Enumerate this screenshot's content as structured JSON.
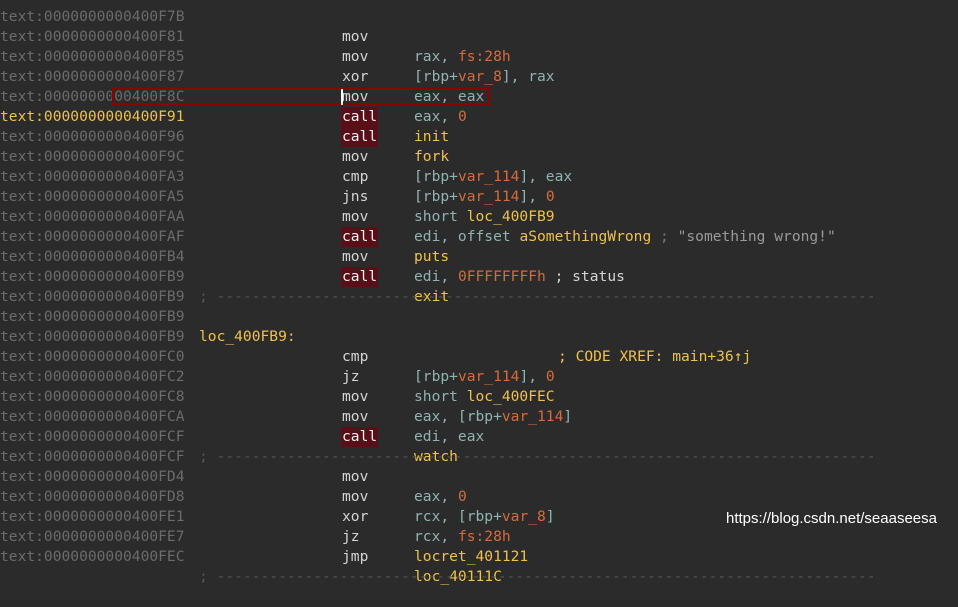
{
  "listing": {
    "top_partial": {
      "addr": "text:0000000000400F7B",
      "mn": "mov",
      "op1": "rax",
      "op2": "fs:28h"
    },
    "l1": {
      "addr": "text:0000000000400F81",
      "mn": "mov",
      "a": "[rbp+",
      "b": "var_8",
      "c": "], ",
      "d": "rax"
    },
    "l2": {
      "addr": "text:0000000000400F85",
      "mn": "xor",
      "a": "eax, eax"
    },
    "l3": {
      "addr": "text:0000000000400F87",
      "mn": "mov",
      "a": "eax, ",
      "b": "0"
    },
    "l4": {
      "addr": "text:0000000000400F8C",
      "mn": "call",
      "a": "init"
    },
    "l5": {
      "addr": "text:0000000000400F91",
      "mn": "call",
      "a": "fork"
    },
    "l6": {
      "addr": "text:0000000000400F96",
      "mn": "mov",
      "a": "[rbp+",
      "b": "var_114",
      "c": "], eax"
    },
    "l7": {
      "addr": "text:0000000000400F9C",
      "mn": "cmp",
      "a": "[rbp+",
      "b": "var_114",
      "c": "], ",
      "d": "0"
    },
    "l8": {
      "addr": "text:0000000000400FA3",
      "mn": "jns",
      "a": "short ",
      "b": "loc_400FB9"
    },
    "l9": {
      "addr": "text:0000000000400FA5",
      "mn": "mov",
      "a": "edi, offset ",
      "b": "aSomethingWrong",
      "c": " ; ",
      "d": "\"something wrong!\""
    },
    "l10": {
      "addr": "text:0000000000400FAA",
      "mn": "call",
      "a": "puts"
    },
    "l11": {
      "addr": "text:0000000000400FAF",
      "mn": "mov",
      "a": "edi, ",
      "b": "0FFFFFFFFh",
      "c": " ; status"
    },
    "l12": {
      "addr": "text:0000000000400FB4",
      "mn": "call",
      "a": "exit"
    },
    "l13": {
      "addr": "text:0000000000400FB9",
      "sep": "; ---------------------------------------------------------------------------"
    },
    "l14": {
      "addr": "text:0000000000400FB9"
    },
    "l15": {
      "addr": "text:0000000000400FB9",
      "label": "loc_400FB9:",
      "xref": "; CODE XREF: main+36↑j"
    },
    "l16": {
      "addr": "text:0000000000400FB9",
      "mn": "cmp",
      "a": "[rbp+",
      "b": "var_114",
      "c": "], ",
      "d": "0"
    },
    "l17": {
      "addr": "text:0000000000400FC0",
      "mn": "jz",
      "a": "short ",
      "b": "loc_400FEC"
    },
    "l18": {
      "addr": "text:0000000000400FC2",
      "mn": "mov",
      "a": "eax, [rbp+",
      "b": "var_114",
      "c": "]"
    },
    "l19": {
      "addr": "text:0000000000400FC8",
      "mn": "mov",
      "a": "edi, eax"
    },
    "l20": {
      "addr": "text:0000000000400FCA",
      "mn": "call",
      "a": "watch"
    },
    "l21": {
      "addr": "text:0000000000400FCF",
      "sep": "; ---------------------------------------------------------------------------"
    },
    "l22": {
      "addr": "text:0000000000400FCF",
      "mn": "mov",
      "a": "eax, ",
      "b": "0"
    },
    "l23": {
      "addr": "text:0000000000400FD4",
      "mn": "mov",
      "a": "rcx, [rbp+",
      "b": "var_8",
      "c": "]"
    },
    "l24": {
      "addr": "text:0000000000400FD8",
      "mn": "xor",
      "a": "rcx, ",
      "b": "fs:28h"
    },
    "l25": {
      "addr": "text:0000000000400FE1",
      "mn": "jz",
      "a": "locret_401121"
    },
    "l26": {
      "addr": "text:0000000000400FE7",
      "mn": "jmp",
      "a": "loc_40111C"
    },
    "l27": {
      "addr": "text:0000000000400FEC",
      "sep": "; ---------------------------------------------------------------------------"
    }
  },
  "watermark": "https://blog.csdn.net/seaaseesa",
  "colors": {
    "background": "#2b2b2b",
    "address": "#6b6b6b",
    "current_address": "#f0c14b",
    "call_bg": "#5a0f18",
    "highlight_border": "#8b0000"
  }
}
